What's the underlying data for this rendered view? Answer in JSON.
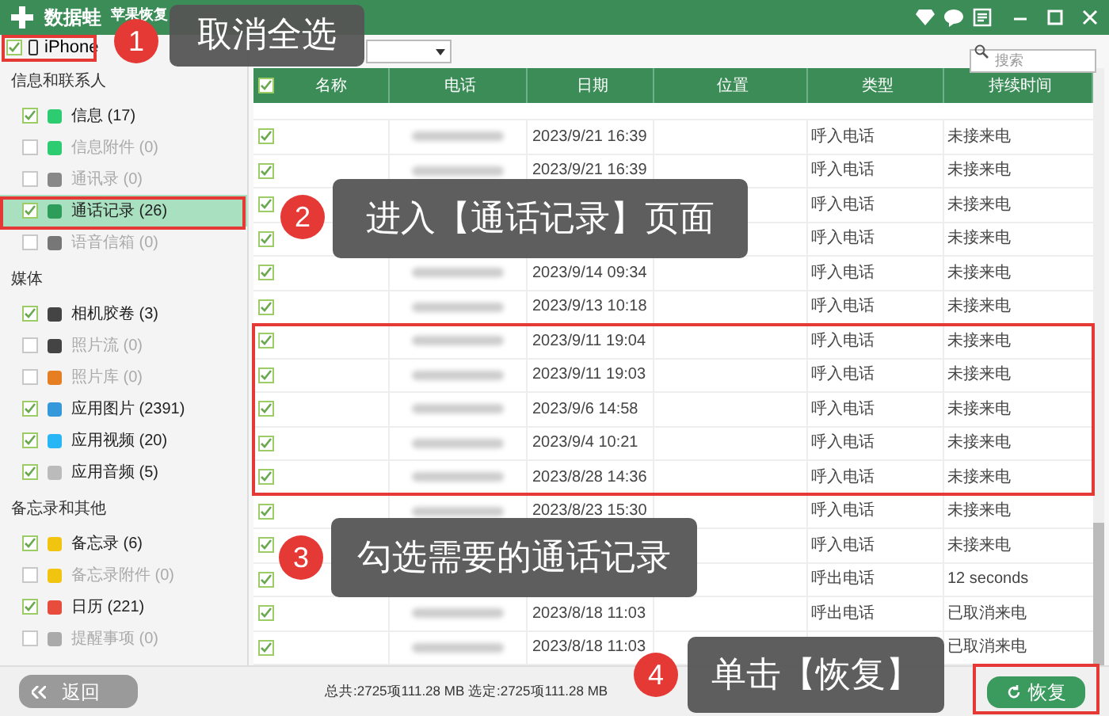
{
  "window": {
    "logo": "数据蛙",
    "subtitle": "苹果恢复"
  },
  "device": {
    "name": "iPhone",
    "checked": true
  },
  "sidebar": {
    "groups": [
      {
        "title": "信息和联系人",
        "items": [
          {
            "label": "信息 (17)",
            "checked": true,
            "selected": false
          },
          {
            "label": "信息附件 (0)",
            "checked": false,
            "selected": false
          },
          {
            "label": "通讯录 (0)",
            "checked": false,
            "selected": false
          },
          {
            "label": "通话记录 (26)",
            "checked": true,
            "selected": true
          },
          {
            "label": "语音信箱 (0)",
            "checked": false,
            "selected": false
          }
        ]
      },
      {
        "title": "媒体",
        "items": [
          {
            "label": "相机胶卷 (3)",
            "checked": true,
            "selected": false
          },
          {
            "label": "照片流 (0)",
            "checked": false,
            "selected": false
          },
          {
            "label": "照片库 (0)",
            "checked": false,
            "selected": false
          },
          {
            "label": "应用图片 (2391)",
            "checked": true,
            "selected": false
          },
          {
            "label": "应用视频 (20)",
            "checked": true,
            "selected": false
          },
          {
            "label": "应用音频 (5)",
            "checked": true,
            "selected": false
          }
        ]
      },
      {
        "title": "备忘录和其他",
        "items": [
          {
            "label": "备忘录 (6)",
            "checked": true,
            "selected": false
          },
          {
            "label": "备忘录附件 (0)",
            "checked": false,
            "selected": false
          },
          {
            "label": "日历 (221)",
            "checked": true,
            "selected": false
          },
          {
            "label": "提醒事项 (0)",
            "checked": false,
            "selected": false
          }
        ]
      }
    ]
  },
  "search": {
    "placeholder": "搜索"
  },
  "table": {
    "header_checked": true,
    "columns": [
      "名称",
      "电话",
      "日期",
      "位置",
      "类型",
      "持续时间"
    ],
    "rows": [
      {
        "checked": true,
        "date": "2023/9/21 16:39",
        "type": "呼入电话",
        "duration": "未接来电"
      },
      {
        "checked": true,
        "date": "2023/9/21 16:39",
        "type": "呼入电话",
        "duration": "未接来电"
      },
      {
        "checked": true,
        "type": "呼入电话",
        "duration": "未接来电"
      },
      {
        "checked": true,
        "type": "呼入电话",
        "duration": "未接来电"
      },
      {
        "checked": true,
        "date": "2023/9/14 09:34",
        "type": "呼入电话",
        "duration": "未接来电"
      },
      {
        "checked": true,
        "date": "2023/9/13 10:18",
        "type": "呼入电话",
        "duration": "未接来电"
      },
      {
        "checked": true,
        "date": "2023/9/11 19:04",
        "type": "呼入电话",
        "duration": "未接来电"
      },
      {
        "checked": true,
        "date": "2023/9/11 19:03",
        "type": "呼入电话",
        "duration": "未接来电"
      },
      {
        "checked": true,
        "date": "2023/9/6 14:58",
        "type": "呼入电话",
        "duration": "未接来电"
      },
      {
        "checked": true,
        "date": "2023/9/4 10:21",
        "type": "呼入电话",
        "duration": "未接来电"
      },
      {
        "checked": true,
        "date": "2023/8/28 14:36",
        "type": "呼入电话",
        "duration": "未接来电"
      },
      {
        "checked": true,
        "date": "2023/8/23 15:30",
        "type": "呼入电话",
        "duration": "未接来电"
      },
      {
        "checked": true,
        "type": "呼入电话",
        "duration": "未接来电"
      },
      {
        "checked": true,
        "type": "呼出电话",
        "duration": "12 seconds"
      },
      {
        "checked": true,
        "date": "2023/8/18 11:03",
        "type": "呼出电话",
        "duration": "已取消来电"
      },
      {
        "checked": true,
        "date": "2023/8/18 11:03",
        "duration": "已取消来电"
      }
    ]
  },
  "bottom": {
    "back": "返回",
    "status": "总共:2725项111.28 MB 选定:2725项111.28 MB",
    "restore": "恢复"
  },
  "callouts": [
    {
      "number": "1",
      "text": "取消全选"
    },
    {
      "number": "2",
      "text": "进入【通话记录】页面"
    },
    {
      "number": "3",
      "text": "勾选需要的通话记录"
    },
    {
      "number": "4",
      "text": "单击【恢复】"
    }
  ]
}
